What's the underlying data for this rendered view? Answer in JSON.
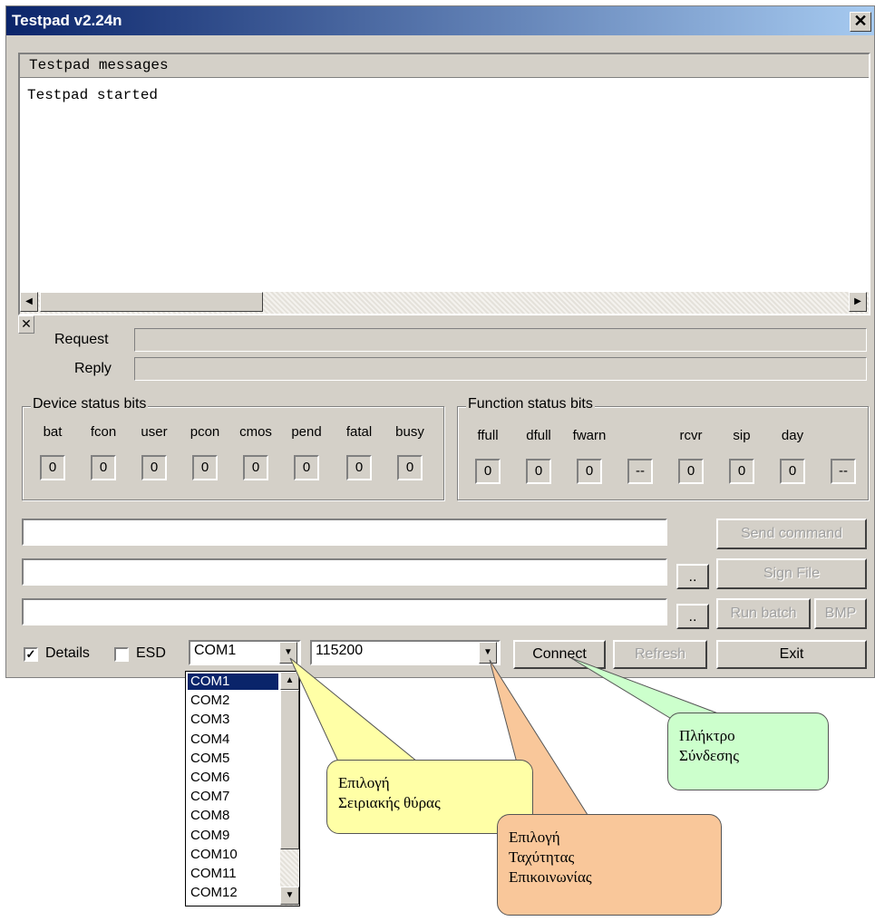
{
  "window": {
    "title": "Testpad v2.24n",
    "close_glyph": "✕"
  },
  "messages": {
    "header": "Testpad messages",
    "lines": [
      "Testpad started"
    ]
  },
  "request_label": "Request",
  "reply_label": "Reply",
  "device_status": {
    "title": "Device status bits",
    "bits": [
      {
        "label": "bat",
        "value": "0"
      },
      {
        "label": "fcon",
        "value": "0"
      },
      {
        "label": "user",
        "value": "0"
      },
      {
        "label": "pcon",
        "value": "0"
      },
      {
        "label": "cmos",
        "value": "0"
      },
      {
        "label": "pend",
        "value": "0"
      },
      {
        "label": "fatal",
        "value": "0"
      },
      {
        "label": "busy",
        "value": "0"
      }
    ]
  },
  "function_status": {
    "title": "Function status bits",
    "bits": [
      {
        "label": "ffull",
        "value": "0"
      },
      {
        "label": "dfull",
        "value": "0"
      },
      {
        "label": "fwarn",
        "value": "0"
      },
      {
        "label": "",
        "value": "--"
      },
      {
        "label": "rcvr",
        "value": "0"
      },
      {
        "label": "sip",
        "value": "0"
      },
      {
        "label": "day",
        "value": "0"
      },
      {
        "label": "",
        "value": "--"
      }
    ]
  },
  "buttons": {
    "send_command": "Send command",
    "browse1": "..",
    "sign_file": "Sign File",
    "browse2": "..",
    "run_batch": "Run batch",
    "bmp": "BMP",
    "connect": "Connect",
    "refresh": "Refresh",
    "exit": "Exit"
  },
  "bottom": {
    "details_label": "Details",
    "details_checked": true,
    "esd_label": "ESD",
    "esd_checked": false,
    "port_value": "COM1",
    "baud_value": "115200"
  },
  "port_options": [
    "COM1",
    "COM2",
    "COM3",
    "COM4",
    "COM5",
    "COM6",
    "COM7",
    "COM8",
    "COM9",
    "COM10",
    "COM11",
    "COM12"
  ],
  "callouts": {
    "port": "Επιλογή\nΣειριακής θύρας",
    "speed": "Επιλογή\nΤαχύτητας\nΕπικοινωνίας",
    "connect": "Πλήκτρο\nΣύνδεσης"
  },
  "colors": {
    "callout_port": "#ffffa6",
    "callout_speed": "#f9c79a",
    "callout_connect": "#ccffcc",
    "titlebar": "#0a246a"
  }
}
